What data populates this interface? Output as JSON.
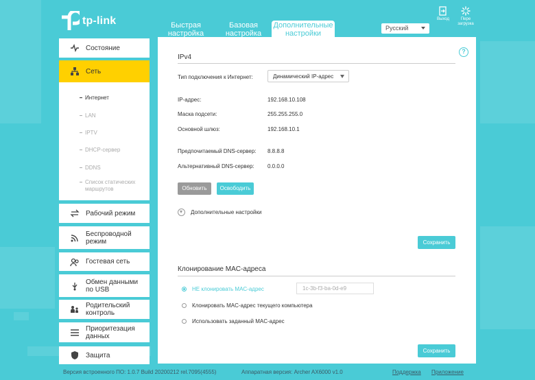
{
  "brand": {
    "name": "tp-link"
  },
  "tabs": [
    {
      "label": "Быстрая настройка"
    },
    {
      "label": "Базовая настройка"
    },
    {
      "label": "Дополнительные настройки"
    }
  ],
  "language": {
    "selected": "Русский"
  },
  "top_actions": {
    "logout": "Выход",
    "reboot": "Пере загрузка"
  },
  "sidebar": {
    "items": [
      {
        "label": "Состояние",
        "icon": "pulse-icon"
      },
      {
        "label": "Сеть",
        "icon": "network-icon"
      },
      {
        "label": "Рабочий режим",
        "icon": "mode-icon"
      },
      {
        "label": "Беспроводной режим",
        "icon": "wireless-icon"
      },
      {
        "label": "Гостевая сеть",
        "icon": "guest-icon"
      },
      {
        "label": "Обмен данными по USB",
        "icon": "usb-icon"
      },
      {
        "label": "Родительский контроль",
        "icon": "parental-icon"
      },
      {
        "label": "Приоритезация данных",
        "icon": "qos-icon"
      },
      {
        "label": "Защита",
        "icon": "shield-icon"
      }
    ],
    "sub_items": [
      {
        "label": "Интернет"
      },
      {
        "label": "LAN"
      },
      {
        "label": "IPTV"
      },
      {
        "label": "DHCP-сервер"
      },
      {
        "label": "DDNS"
      },
      {
        "label": "Список статических маршрутов"
      }
    ]
  },
  "ipv4": {
    "title": "IPv4",
    "conn_type_label": "Тип подключения к Интернет:",
    "conn_type_value": "Динамический IP-адрес",
    "ip_label": "IP-адрес:",
    "ip_value": "192.168.10.108",
    "mask_label": "Маска подсети:",
    "mask_value": "255.255.255.0",
    "gw_label": "Основной шлюз:",
    "gw_value": "192.168.10.1",
    "dns1_label": "Предпочитаемый DNS-сервер:",
    "dns1_value": "8.8.8.8",
    "dns2_label": "Альтернативный DNS-сервер:",
    "dns2_value": "0.0.0.0",
    "renew_label": "Обновить",
    "release_label": "Освободить",
    "advanced_label": "Дополнительные настройки",
    "save_label": "Сохранить"
  },
  "mac_clone": {
    "title": "Клонирование MAC-адреса",
    "options": [
      {
        "label": "НЕ клонировать MAC-адрес",
        "selected": true
      },
      {
        "label": "Клонировать MAC-адрес текущего компьютера",
        "selected": false
      },
      {
        "label": "Использовать заданный MAC-адрес",
        "selected": false
      }
    ],
    "mac_placeholder": "1c-3b-f3-ba-0d-e9",
    "save_label": "Сохранить"
  },
  "footer": {
    "firmware": "Версия встроенного ПО: 1.0.7 Build 20200212 rel.7095(4555)",
    "hardware": "Аппаратная версия: Archer AX6000 v1.0",
    "support": "Поддержка",
    "app": "Приложение"
  },
  "colors": {
    "accent": "#4acbd6",
    "active_nav": "#ffd000"
  }
}
